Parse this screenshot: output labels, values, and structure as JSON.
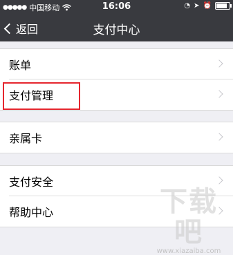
{
  "status": {
    "carrier": "中国移动",
    "time": "16:06",
    "battery_level": 0.85
  },
  "nav": {
    "back_label": "返回",
    "title": "支付中心"
  },
  "groups": [
    {
      "items": [
        {
          "label": "账单"
        },
        {
          "label": "支付管理"
        }
      ]
    },
    {
      "items": [
        {
          "label": "亲属卡"
        }
      ]
    },
    {
      "items": [
        {
          "label": "支付安全"
        },
        {
          "label": "帮助中心"
        }
      ]
    }
  ],
  "highlight_target": "支付管理",
  "watermark": {
    "text": "下载吧",
    "url": "www.xiazaiba.com"
  }
}
